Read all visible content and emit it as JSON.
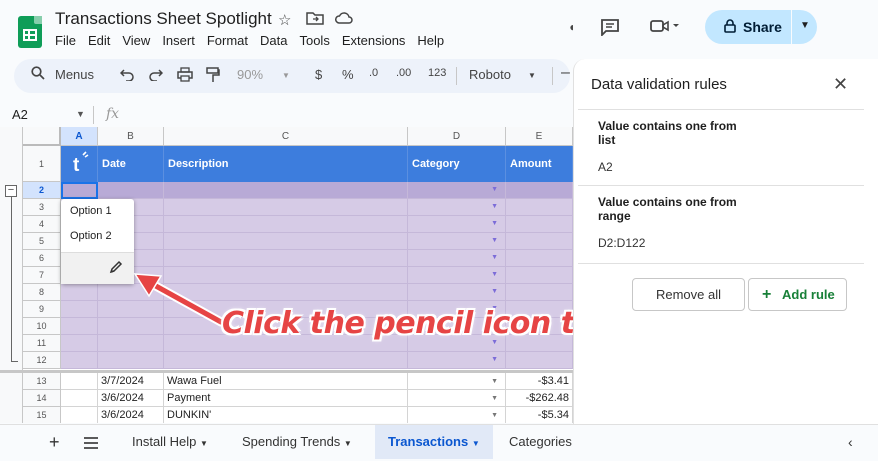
{
  "app": {
    "doc_title": "Transactions Sheet Spotlight",
    "menu": [
      "File",
      "Edit",
      "View",
      "Insert",
      "Format",
      "Data",
      "Tools",
      "Extensions",
      "Help"
    ],
    "share_label": "Share"
  },
  "toolbar": {
    "search_label": "Menus",
    "zoom": "90%",
    "currency": "$",
    "percent": "%",
    "dec_decrease": ".0",
    "dec_increase": ".00",
    "number_format": "123",
    "font": "Roboto"
  },
  "formula_bar": {
    "namebox": "A2",
    "fx": "fx"
  },
  "grid": {
    "columns": [
      "A",
      "B",
      "C",
      "D",
      "E"
    ],
    "headers": {
      "date": "Date",
      "description": "Description",
      "category": "Category",
      "amount": "Amount",
      "logo": "t"
    },
    "rows_numbers": [
      "1",
      "2",
      "3",
      "4",
      "5",
      "6",
      "7",
      "8",
      "9",
      "10",
      "11",
      "12",
      "13",
      "14",
      "15"
    ],
    "data_rows": [
      {
        "row": "13",
        "date": "3/7/2024",
        "description": "Wawa Fuel",
        "amount": "-$3.41"
      },
      {
        "row": "14",
        "date": "3/6/2024",
        "description": "Payment",
        "amount": "-$262.48"
      },
      {
        "row": "15",
        "date": "3/6/2024",
        "description": "DUNKIN'",
        "amount": "-$5.34"
      }
    ]
  },
  "dropdown_popup": {
    "options": [
      "Option 1",
      "Option 2"
    ]
  },
  "annotation": {
    "text": "Click the pencil icon to edit"
  },
  "panel": {
    "title": "Data validation rules",
    "rules": [
      {
        "title": "Value contains one from list",
        "value": "A2"
      },
      {
        "title": "Value contains one from range",
        "value": "D2:D122"
      }
    ],
    "remove_all": "Remove all",
    "add_rule": "Add rule"
  },
  "tabs": [
    "Install Help",
    "Spending Trends",
    "Transactions",
    "Categories"
  ],
  "colors": {
    "header_blue": "#3d7ddd",
    "purple_fill": "#d6cbe6",
    "share_bg": "#c2e7ff",
    "annotation_red": "#e64444",
    "add_rule_green": "#188038"
  }
}
